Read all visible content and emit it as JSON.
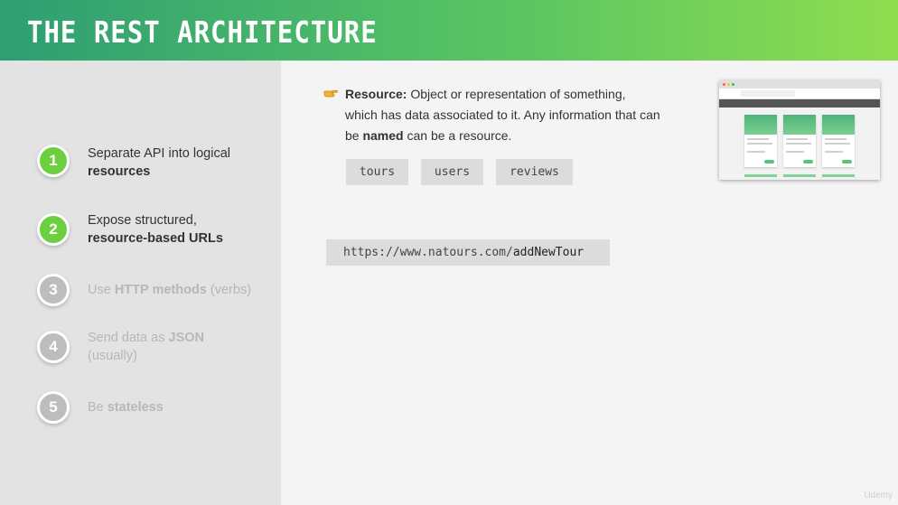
{
  "header": {
    "title": "THE REST ARCHITECTURE"
  },
  "steps": [
    {
      "number": "1",
      "text_plain": "Separate API into logical",
      "text_bold": "resources",
      "state": "active"
    },
    {
      "number": "2",
      "text_plain": "Expose structured,",
      "text_bold": "resource-based URLs",
      "state": "active"
    },
    {
      "number": "3",
      "text_pre": "Use ",
      "text_bold": "HTTP methods",
      "text_post": " (verbs)",
      "state": "inactive"
    },
    {
      "number": "4",
      "text_pre": "Send data as ",
      "text_bold": "JSON",
      "text_post": "(usually)",
      "state": "inactive"
    },
    {
      "number": "5",
      "text_pre": "Be ",
      "text_bold": "stateless",
      "state": "inactive"
    }
  ],
  "definition": {
    "term": "Resource:",
    "text_1": " Object or representation of something, which has data associated to it. Any information that can be ",
    "bold_word": "named",
    "text_2": " can be a resource.",
    "icon": "pointing-hand-icon"
  },
  "tags": [
    "tours",
    "users",
    "reviews"
  ],
  "url": {
    "base": "https://www.natours.com/",
    "path": "addNewTour"
  },
  "watermark": "Udemy",
  "colors": {
    "header_gradient_start": "#2e9e73",
    "header_gradient_end": "#8fdd4f",
    "step_active": "#6bcf3f",
    "step_inactive": "#bdbdbd"
  }
}
